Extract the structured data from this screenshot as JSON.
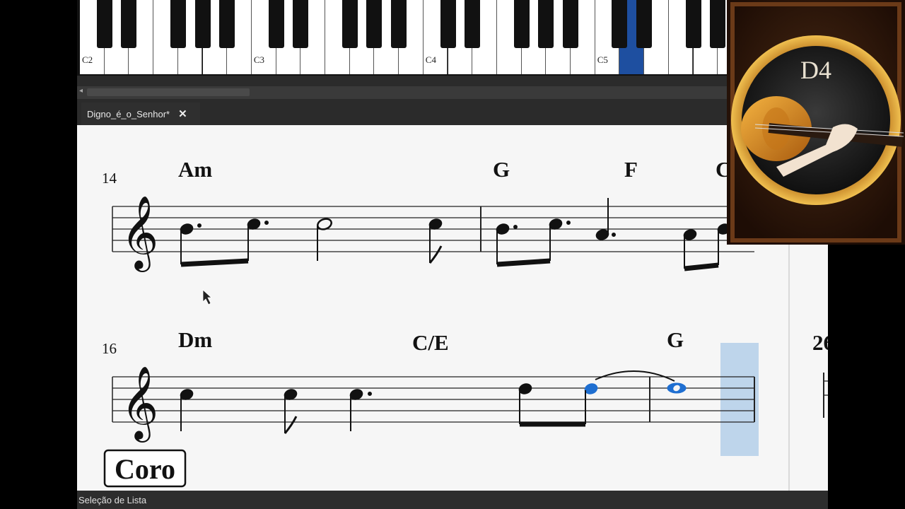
{
  "piano": {
    "octave_labels": [
      "C2",
      "C3",
      "C4",
      "C5"
    ],
    "highlighted_key": "D5"
  },
  "tab": {
    "title": "Digno_é_o_Senhor*",
    "close_label": "✕"
  },
  "score": {
    "systems": [
      {
        "measure_number": "14",
        "chords": [
          "Am",
          "G",
          "F",
          "C"
        ]
      },
      {
        "measure_number": "16",
        "chords": [
          "Dm",
          "C/E",
          "G"
        ],
        "next_measure_number": "26"
      }
    ],
    "rehearsal_mark": "Coro",
    "selected_note_color": "#1f6fd1"
  },
  "status": {
    "text": "Seleção de Lista"
  },
  "instrument": {
    "name": "violin-icon",
    "note_display": "D4"
  }
}
